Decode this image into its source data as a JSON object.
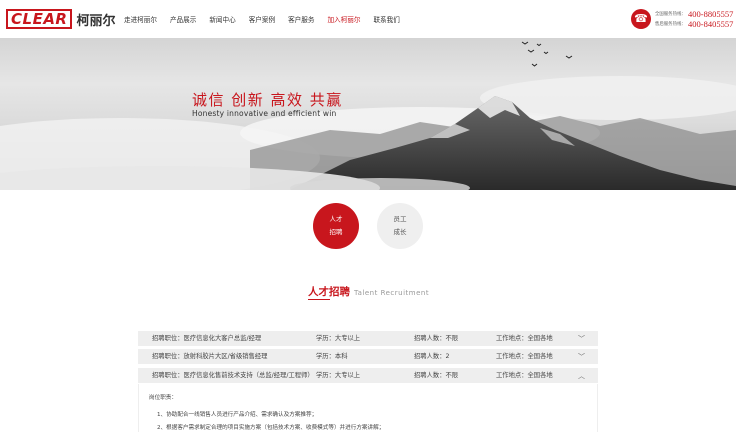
{
  "header": {
    "logo_en": "CLEAR",
    "logo_cn": "柯丽尔",
    "nav": [
      {
        "label": "走进柯丽尔",
        "active": false
      },
      {
        "label": "产品展示",
        "active": false
      },
      {
        "label": "新闻中心",
        "active": false
      },
      {
        "label": "客户案例",
        "active": false
      },
      {
        "label": "客户服务",
        "active": false
      },
      {
        "label": "加入柯丽尔",
        "active": true
      },
      {
        "label": "联系我们",
        "active": false
      }
    ],
    "phones": [
      {
        "label": "全国服务热线：",
        "number": "400-8805557"
      },
      {
        "label": "售后服务热线：",
        "number": "400-8405557"
      }
    ]
  },
  "banner": {
    "slogan_cn": "诚信 创新 高效 共赢",
    "slogan_en": "Honesty innovative and efficient win"
  },
  "tabs": [
    {
      "line1": "人才",
      "line2": "招聘",
      "active": true
    },
    {
      "line1": "员工",
      "line2": "成长",
      "active": false
    }
  ],
  "section": {
    "title_cn": "人才招聘",
    "title_en": "Talent Recruitment"
  },
  "jobs": [
    {
      "title": "招聘职位：医疗信息化大客户总监/经理",
      "education": "学历：大专以上",
      "headcount": "招聘人数：不限",
      "location": "工作地点：全国各地",
      "expanded": false
    },
    {
      "title": "招聘职位：放射科胶片大区/省级销售经理",
      "education": "学历：本科",
      "headcount": "招聘人数：2",
      "location": "工作地点：全国各地",
      "expanded": false
    },
    {
      "title": "招聘职位：医疗信息化售前技术支持（总监/经理/工程师）",
      "education": "学历：大专以上",
      "headcount": "招聘人数：不限",
      "location": "工作地点：全国各地",
      "expanded": true
    }
  ],
  "job_detail": {
    "heading": "岗位职责：",
    "lines": [
      "1、协助配合一线销售人员进行产品介绍、需求确认及方案推荐；",
      "2、根据客户需求制定合理的项目实施方案（包括技术方案、收费模式等）并进行方案讲解；"
    ]
  },
  "icons": {
    "phone": "phone-icon",
    "chevron_down": "chevron-down-icon",
    "chevron_up": "chevron-up-icon"
  },
  "colors": {
    "brand_red": "#c8161d"
  }
}
